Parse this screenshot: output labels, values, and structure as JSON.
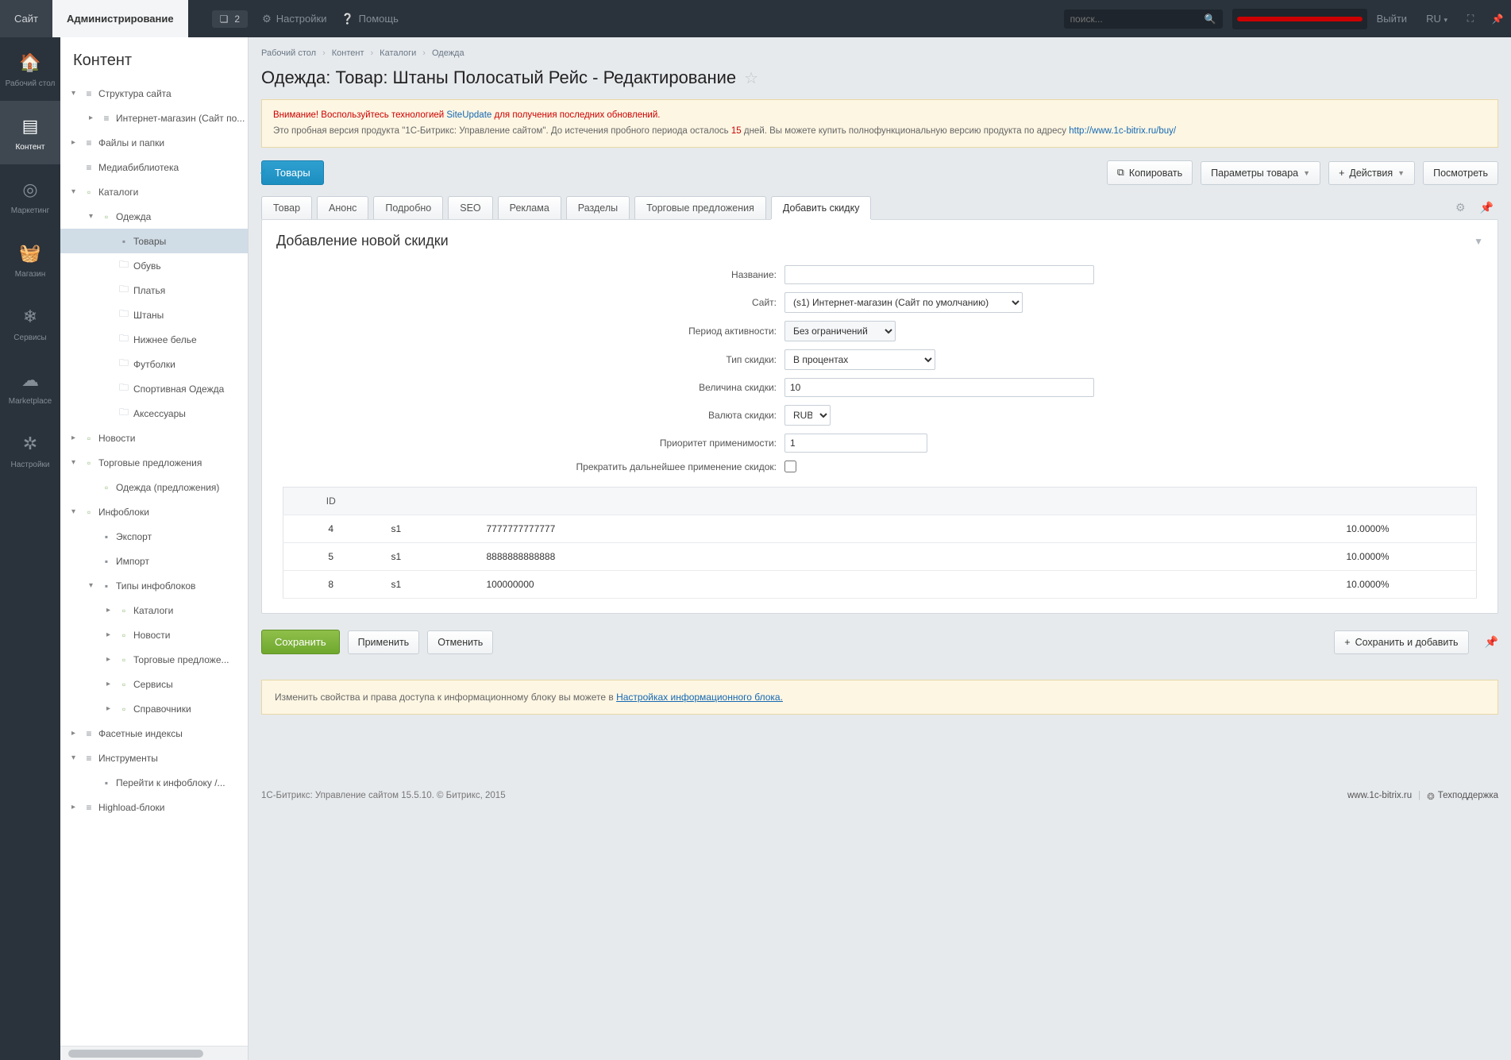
{
  "topbar": {
    "site_tab": "Сайт",
    "admin_tab": "Администрирование",
    "notif_count": "2",
    "settings": "Настройки",
    "help": "Помощь",
    "search_placeholder": "поиск...",
    "logout": "Выйти",
    "lang": "RU"
  },
  "rail": [
    {
      "label": "Рабочий стол",
      "icon": "home"
    },
    {
      "label": "Контент",
      "icon": "content"
    },
    {
      "label": "Маркетинг",
      "icon": "target"
    },
    {
      "label": "Магазин",
      "icon": "basket"
    },
    {
      "label": "Сервисы",
      "icon": "services"
    },
    {
      "label": "Marketplace",
      "icon": "cloud"
    },
    {
      "label": "Настройки",
      "icon": "gear"
    }
  ],
  "sidebar": {
    "title": "Контент",
    "items": [
      {
        "indent": 0,
        "toggle": "▾",
        "icon": "struct",
        "label": "Структура сайта"
      },
      {
        "indent": 1,
        "toggle": "▸",
        "icon": "struct",
        "label": "Интернет-магазин (Сайт по..."
      },
      {
        "indent": 0,
        "toggle": "▸",
        "icon": "struct",
        "label": "Файлы и папки"
      },
      {
        "indent": 0,
        "toggle": "",
        "icon": "struct",
        "label": "Медиабиблиотека"
      },
      {
        "indent": 0,
        "toggle": "▾",
        "icon": "block",
        "label": "Каталоги"
      },
      {
        "indent": 1,
        "toggle": "▾",
        "icon": "block",
        "label": "Одежда"
      },
      {
        "indent": 2,
        "toggle": "",
        "icon": "dot",
        "label": "Товары",
        "active": true
      },
      {
        "indent": 2,
        "toggle": "",
        "icon": "folder",
        "label": "Обувь"
      },
      {
        "indent": 2,
        "toggle": "",
        "icon": "folder",
        "label": "Платья"
      },
      {
        "indent": 2,
        "toggle": "",
        "icon": "folder",
        "label": "Штаны"
      },
      {
        "indent": 2,
        "toggle": "",
        "icon": "folder",
        "label": "Нижнее белье"
      },
      {
        "indent": 2,
        "toggle": "",
        "icon": "folder",
        "label": "Футболки"
      },
      {
        "indent": 2,
        "toggle": "",
        "icon": "folder",
        "label": "Спортивная Одежда"
      },
      {
        "indent": 2,
        "toggle": "",
        "icon": "folder",
        "label": "Аксессуары"
      },
      {
        "indent": 0,
        "toggle": "▸",
        "icon": "block",
        "label": "Новости"
      },
      {
        "indent": 0,
        "toggle": "▾",
        "icon": "block",
        "label": "Торговые предложения"
      },
      {
        "indent": 1,
        "toggle": "",
        "icon": "block",
        "label": "Одежда (предложения)"
      },
      {
        "indent": 0,
        "toggle": "▾",
        "icon": "block",
        "label": "Инфоблоки"
      },
      {
        "indent": 1,
        "toggle": "",
        "icon": "dot",
        "label": "Экспорт"
      },
      {
        "indent": 1,
        "toggle": "",
        "icon": "dot",
        "label": "Импорт"
      },
      {
        "indent": 1,
        "toggle": "▾",
        "icon": "dot",
        "label": "Типы инфоблоков"
      },
      {
        "indent": 2,
        "toggle": "▸",
        "icon": "block",
        "label": "Каталоги"
      },
      {
        "indent": 2,
        "toggle": "▸",
        "icon": "block",
        "label": "Новости"
      },
      {
        "indent": 2,
        "toggle": "▸",
        "icon": "block",
        "label": "Торговые предложе..."
      },
      {
        "indent": 2,
        "toggle": "▸",
        "icon": "block",
        "label": "Сервисы"
      },
      {
        "indent": 2,
        "toggle": "▸",
        "icon": "block",
        "label": "Справочники"
      },
      {
        "indent": 0,
        "toggle": "▸",
        "icon": "struct",
        "label": "Фасетные индексы"
      },
      {
        "indent": 0,
        "toggle": "▾",
        "icon": "struct",
        "label": "Инструменты"
      },
      {
        "indent": 1,
        "toggle": "",
        "icon": "dot",
        "label": "Перейти к инфоблоку /..."
      },
      {
        "indent": 0,
        "toggle": "▸",
        "icon": "struct",
        "label": "Highload-блоки"
      }
    ]
  },
  "breadcrumb": [
    "Рабочий стол",
    "Контент",
    "Каталоги",
    "Одежда"
  ],
  "page_title": "Одежда: Товар: Штаны Полосатый Рейс - Редактирование",
  "notice": {
    "line1_a": "Внимание! Воспользуйтесь технологией ",
    "line1_link": "SiteUpdate",
    "line1_b": " для получения последних обновлений.",
    "line2_a": "Это пробная версия продукта \"1С-Битрикс: Управление сайтом\". До истечения пробного периода осталось ",
    "line2_days": "15",
    "line2_b": " дней. Вы можете купить полнофункциональную версию продукта по адресу ",
    "line2_link": "http://www.1c-bitrix.ru/buy/"
  },
  "toolbar": {
    "back": "Товары",
    "copy": "Копировать",
    "params": "Параметры товара",
    "actions": "Действия",
    "view": "Посмотреть"
  },
  "tabs": [
    "Товар",
    "Анонс",
    "Подробно",
    "SEO",
    "Реклама",
    "Разделы",
    "Торговые предложения",
    "Добавить скидку"
  ],
  "active_tab": 7,
  "panel_title": "Добавление новой скидки",
  "form": {
    "name_label": "Название:",
    "name_value": "",
    "site_label": "Сайт:",
    "site_value": "(s1) Интернет-магазин (Сайт по умолчанию)",
    "period_label": "Период активности:",
    "period_value": "Без ограничений",
    "type_label": "Тип скидки:",
    "type_value": "В процентах",
    "value_label": "Величина скидки:",
    "value_value": "10",
    "currency_label": "Валюта скидки:",
    "currency_value": "RUB",
    "priority_label": "Приоритет применимости:",
    "priority_value": "1",
    "stop_label": "Прекратить дальнейшее применение скидок:"
  },
  "table": {
    "headers": [
      "ID",
      "",
      "",
      ""
    ],
    "rows": [
      {
        "id": "4",
        "site": "s1",
        "code": "7777777777777",
        "pct": "10.0000%"
      },
      {
        "id": "5",
        "site": "s1",
        "code": "8888888888888",
        "pct": "10.0000%"
      },
      {
        "id": "8",
        "site": "s1",
        "code": "100000000",
        "pct": "10.0000%"
      }
    ]
  },
  "actions": {
    "save": "Сохранить",
    "apply": "Применить",
    "cancel": "Отменить",
    "save_add": "Сохранить и добавить"
  },
  "info_box": {
    "text": "Изменить свойства и права доступа к информационному блоку вы можете в ",
    "link": "Настройках информационного блока."
  },
  "footer": {
    "left": "1С-Битрикс: Управление сайтом 15.5.10. © Битрикс, 2015",
    "site": "www.1c-bitrix.ru",
    "support": "Техподдержка"
  }
}
